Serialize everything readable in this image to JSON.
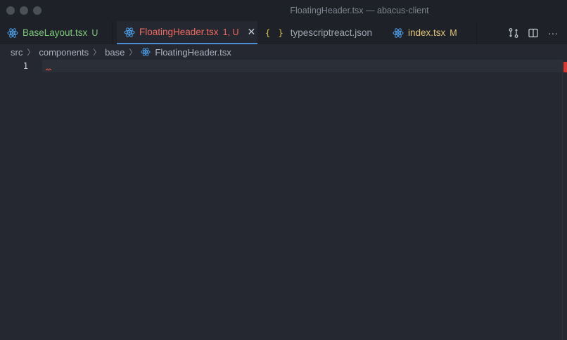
{
  "window": {
    "title": "FloatingHeader.tsx — abacus-client"
  },
  "tabs": [
    {
      "label": "BaseLayout.tsx",
      "status": "U",
      "icon": "react-icon",
      "color": "#7ec97a"
    },
    {
      "label": "FloatingHeader.tsx",
      "status": "1, U",
      "icon": "react-icon",
      "color": "#ef6b62",
      "active": true,
      "close": "✕"
    },
    {
      "label": "typescriptreact.json",
      "status": "",
      "icon": "json-braces-icon",
      "icon_text": "{ }",
      "color": "#9ea5b0"
    },
    {
      "label": "index.tsx",
      "status": "M",
      "icon": "react-icon",
      "color": "#e3c47a"
    }
  ],
  "toolbar": {
    "icons": [
      "compare-changes-icon",
      "split-editor-icon",
      "more-actions-icon"
    ],
    "more_label": "···"
  },
  "breadcrumb": {
    "items": [
      "src",
      "components",
      "base",
      "FloatingHeader.tsx"
    ]
  },
  "editor": {
    "line_numbers": [
      "1"
    ],
    "error_color": "#d43a2e"
  }
}
